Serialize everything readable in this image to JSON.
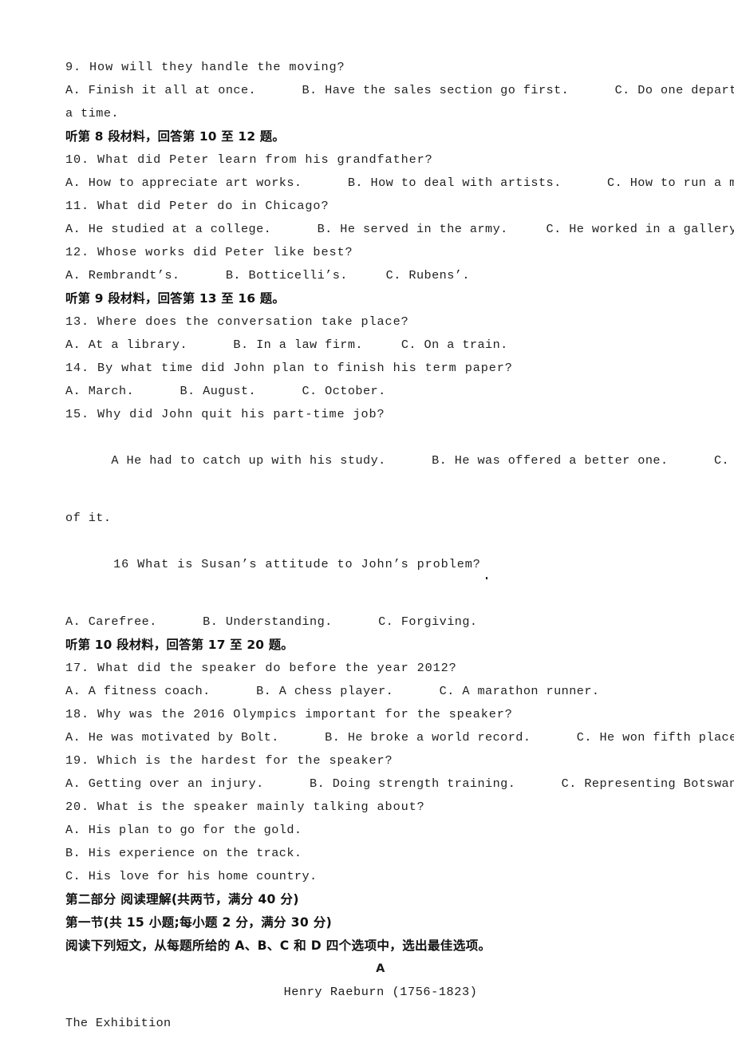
{
  "document": {
    "type": "exam-paper",
    "language": "en-zh",
    "page_background": "#ffffff",
    "text_color": "#1f1f1f"
  },
  "lines": {
    "q9_stem": "9. How will they handle the moving?",
    "q9_options": "A. Finish it all at once.      B. Have the sales section go first.      C. Do one department at",
    "q9_options_wrap": "a time.",
    "head_section8": "听第 8 段材料，回答第 10 至 12 题。",
    "q10_stem": "10. What did Peter learn from his grandfather?",
    "q10_options": "A. How to appreciate art works.      B. How to deal with artists.      C. How to run a museum.",
    "q11_stem": "11. What did Peter do in Chicago?",
    "q11_options": "A. He studied at a college.      B. He served in the army.     C. He worked in a gallery.",
    "q12_stem": "12. Whose works did Peter like best?",
    "q12_options": "A. Rembrandt’s.      B. Botticelli’s.     C. Rubens’.",
    "head_section9": "听第 9 段材料，回答第 13 至 16 题。",
    "q13_stem": "13. Where does the conversation take place?",
    "q13_options": "A. At a library.      B. In a law firm.     C. On a train.",
    "q14_stem": "14. By what time did John plan to finish his term paper?",
    "q14_options": "A. March.      B. August.      C. October.",
    "q15_stem": "15. Why did John quit his part-time job?",
    "q15_options_a": "A He had to catch up with his study.      B. He was offered a better one.      C. He got tired",
    "q15_options_wrap": "of it.",
    "q16_stem": "16 What is Susan’s attitude to John’s problem?",
    "q16_options": "A. Carefree.      B. Understanding.      C. Forgiving.",
    "head_section10": "听第 10 段材料，回答第 17 至 20 题。",
    "q17_stem": "17. What did the speaker do before the year 2012?",
    "q17_options": "A. A fitness coach.      B. A chess player.      C. A marathon runner.",
    "q18_stem": "18. Why was the 2016 Olympics important for the speaker?",
    "q18_options": "A. He was motivated by Bolt.      B. He broke a world record.      C. He won fifth place.",
    "q19_stem": "19. Which is the hardest for the speaker?",
    "q19_options": "A. Getting over an injury.      B. Doing strength training.      C. Representing Botswana.",
    "q20_stem": "20. What is the speaker mainly talking about?",
    "q20_option_a": "A. His plan to go for the gold.",
    "q20_option_b": "B. His experience on the track.",
    "q20_option_c": "C. His love for his home country.",
    "part2_title": "第二部分 阅读理解(共两节，满分 40 分)",
    "section1_title": "第一节(共 15 小题;每小题 2 分，满分 30 分)",
    "section1_instruction": "阅读下列短文，从每题所给的 A、B、C 和 D 四个选项中，选出最佳选项。",
    "passage_label": "A",
    "passage_title": "Henry Raeburn (1756-1823)",
    "passage_subheading": "The Exhibition"
  }
}
